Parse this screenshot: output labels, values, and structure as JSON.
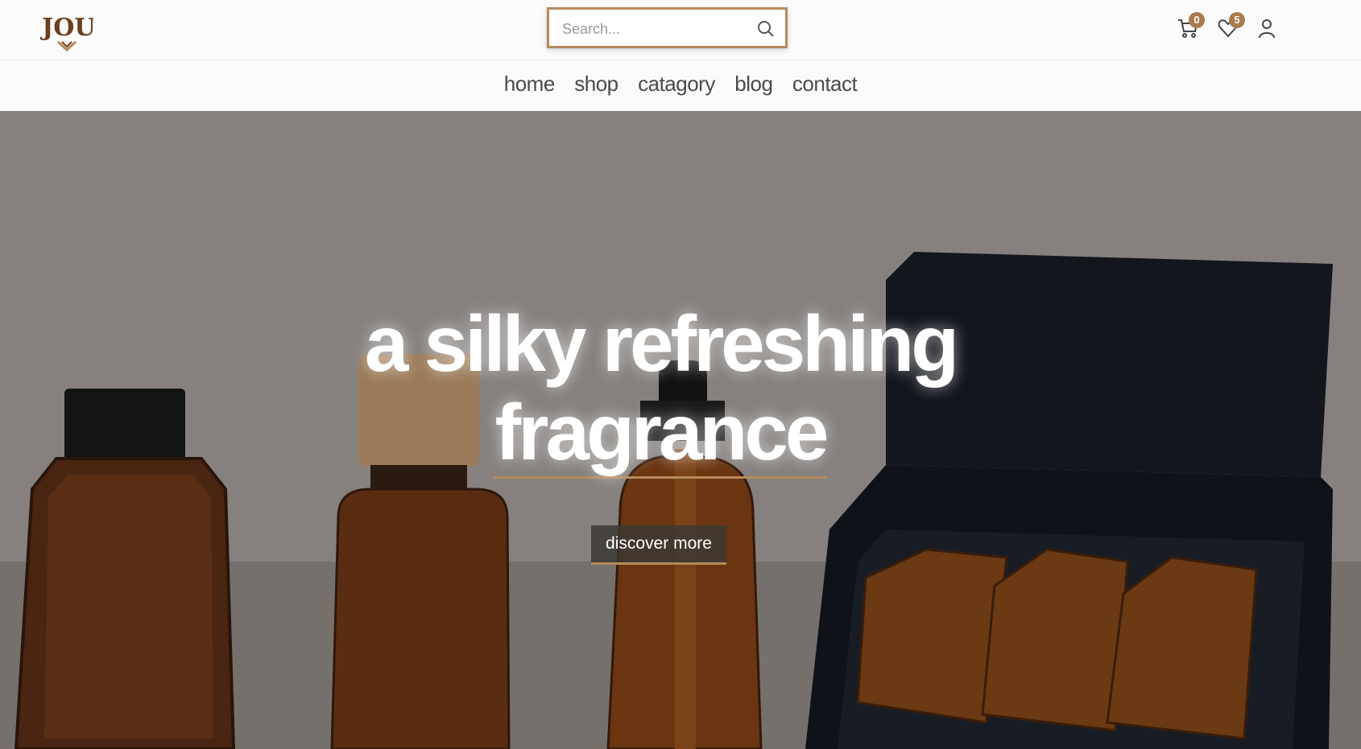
{
  "brand": {
    "logo_text": "JOUD",
    "accent_color": "#a97b4e"
  },
  "search": {
    "placeholder": "Search..."
  },
  "header": {
    "cart_count": "0",
    "wishlist_count": "5"
  },
  "nav": {
    "items": [
      "home",
      "shop",
      "catagory",
      "blog",
      "contact"
    ]
  },
  "hero": {
    "line1": "a silky refreshing",
    "line2": "fragrance",
    "cta_label": "discover more"
  }
}
